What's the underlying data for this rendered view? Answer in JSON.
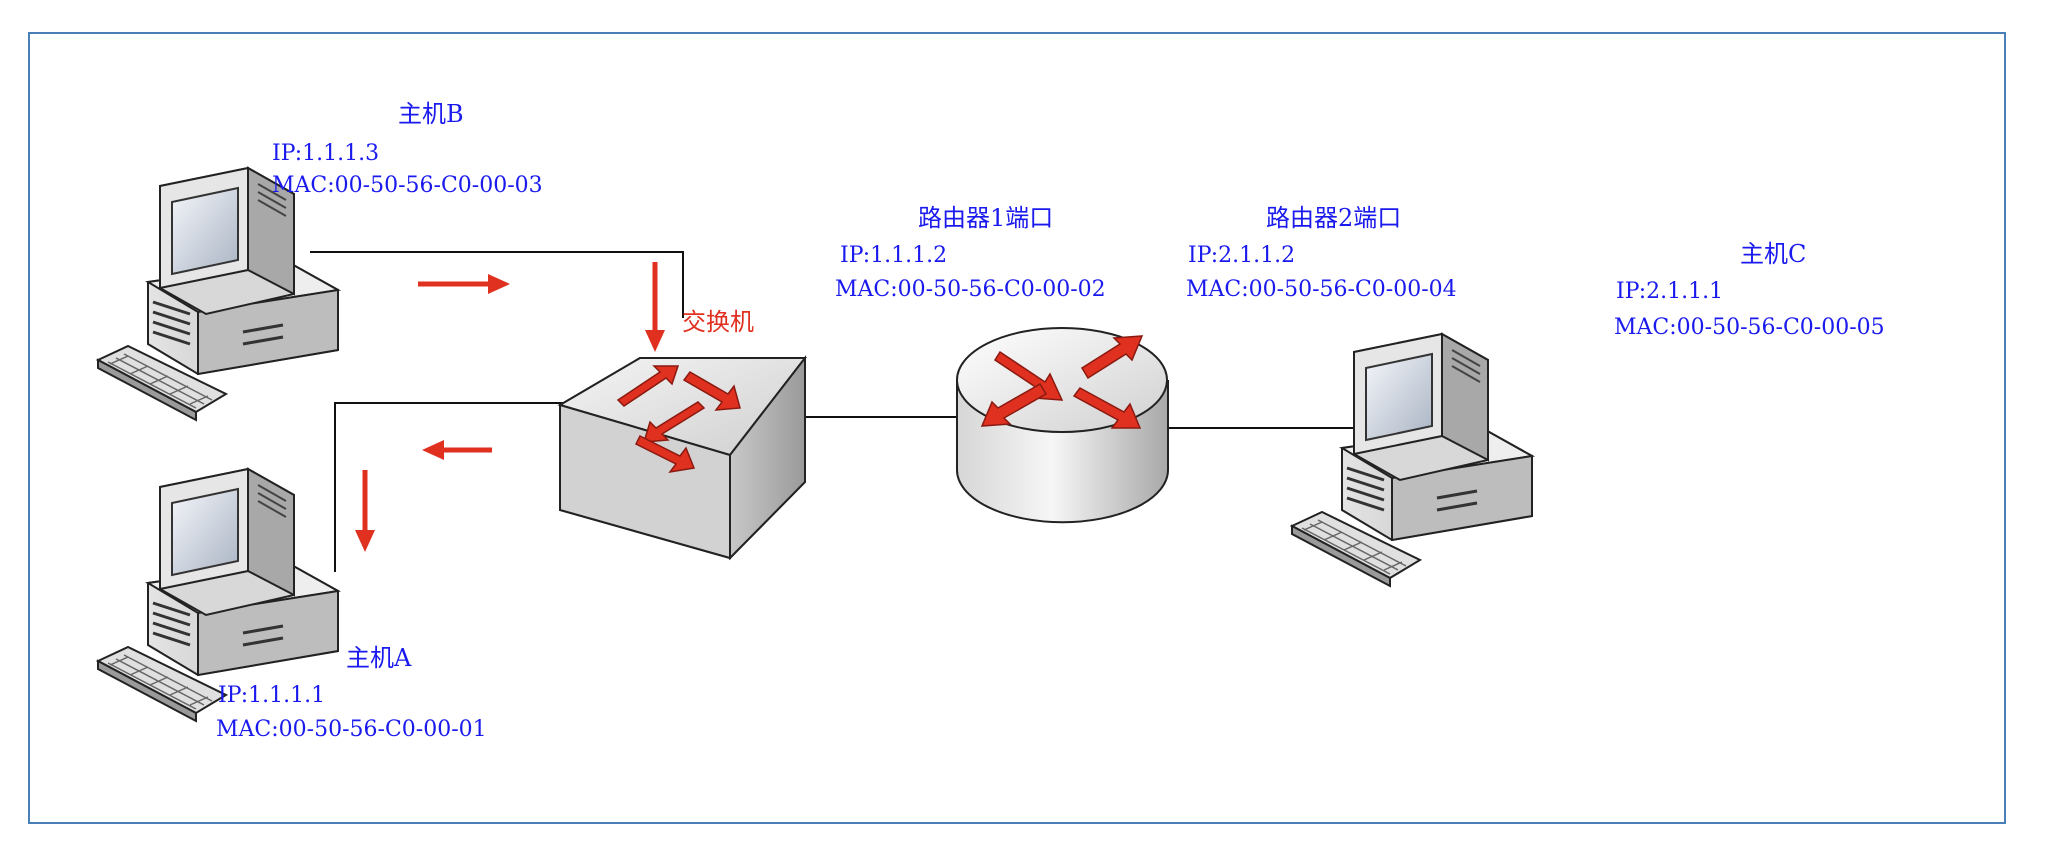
{
  "hosts": {
    "b": {
      "name": "主机B",
      "ip": "IP:1.1.1.3",
      "mac": "MAC:00-50-56-C0-00-03"
    },
    "a": {
      "name": "主机A",
      "ip": "IP:1.1.1.1",
      "mac": "MAC:00-50-56-C0-00-01"
    },
    "c": {
      "name": "主机C",
      "ip": "IP:2.1.1.1",
      "mac": "MAC:00-50-56-C0-00-05"
    }
  },
  "router": {
    "port1": {
      "name": "路由器1端口",
      "ip": "IP:1.1.1.2",
      "mac": "MAC:00-50-56-C0-00-02"
    },
    "port2": {
      "name": "路由器2端口",
      "ip": "IP:2.1.1.2",
      "mac": "MAC:00-50-56-C0-00-04"
    }
  },
  "switch": {
    "label": "交换机"
  },
  "colors": {
    "label_blue": "#1a1aee",
    "arrow_red": "#e03020",
    "frame_blue": "#4a80b8"
  }
}
